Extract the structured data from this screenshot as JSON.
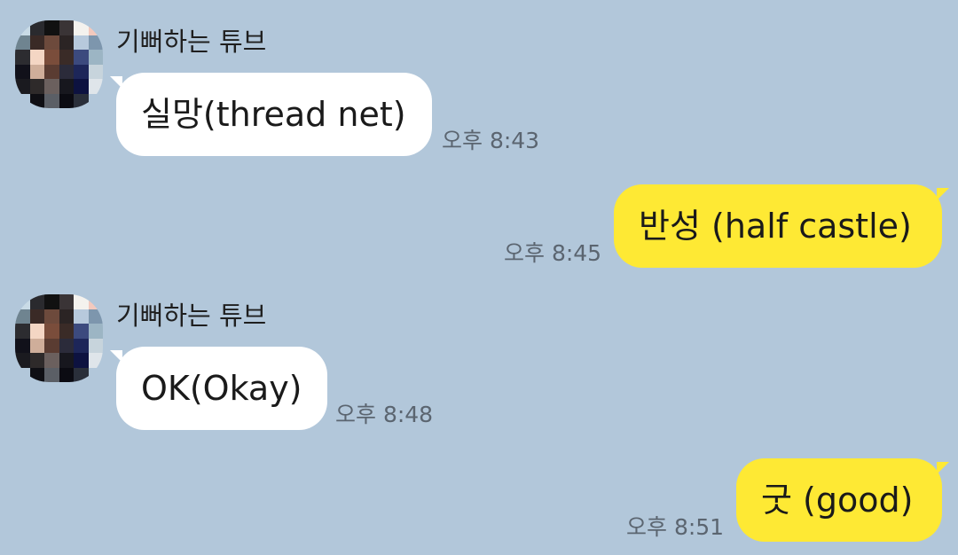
{
  "chat": {
    "background_color": "#b2c7da",
    "incoming_bubble_color": "#ffffff",
    "outgoing_bubble_color": "#fee934",
    "messages": [
      {
        "direction": "incoming",
        "sender": "기뻐하는 튜브",
        "text": "실망(thread net)",
        "time": "오후 8:43"
      },
      {
        "direction": "outgoing",
        "text": "반성 (half castle)",
        "time": "오후 8:45"
      },
      {
        "direction": "incoming",
        "sender": "기뻐하는 튜브",
        "text": "OK(Okay)",
        "time": "오후 8:48"
      },
      {
        "direction": "outgoing",
        "text": "굿 (good)",
        "time": "오후 8:51"
      }
    ]
  },
  "avatar": {
    "type": "pixelated-photo",
    "pixel_colors": [
      "#c9dbe6",
      "#2a2a2e",
      "#111111",
      "#3a3436",
      "#f4f2ee",
      "#f3c9bd",
      "#6f8490",
      "#3a2a26",
      "#6d4a3c",
      "#2b2424",
      "#b7c9dc",
      "#7d96ad",
      "#2c2c30",
      "#f4d6c4",
      "#7a4d3b",
      "#3a2b27",
      "#3c4a7e",
      "#9cb5c4",
      "#11111a",
      "#cfae9a",
      "#5a3c32",
      "#2b2b3a",
      "#1d2659",
      "#c7d4dc",
      "#1a1a1f",
      "#2e2a2a",
      "#6b605e",
      "#17171e",
      "#0d1240",
      "#dfe5ea",
      "#b2c7da",
      "#0f0f14",
      "#5b5f66",
      "#0b0b12",
      "#2a2f3a",
      "#b2c7da"
    ]
  }
}
